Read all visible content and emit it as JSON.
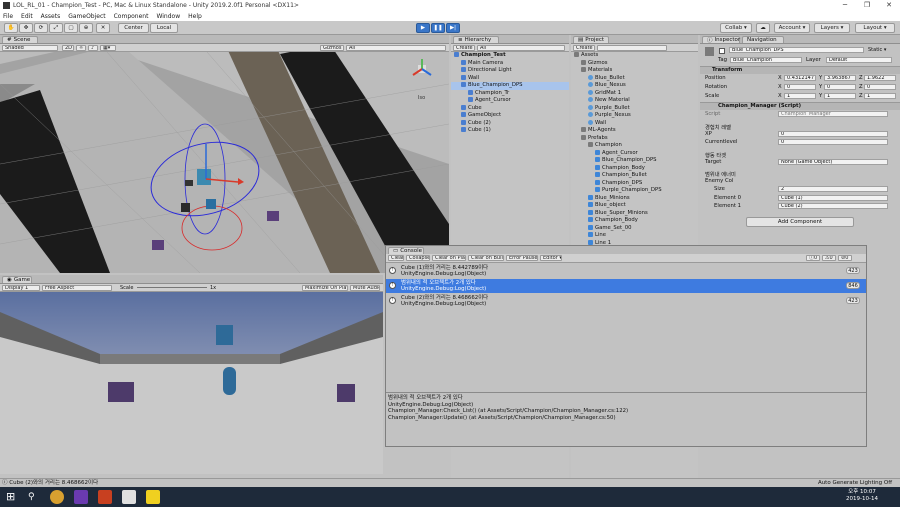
{
  "window": {
    "title": "LOL_RL_01 - Champion_Test - PC, Mac & Linux Standalone - Unity 2019.2.0f1 Personal <DX11>"
  },
  "menu": [
    "File",
    "Edit",
    "Assets",
    "GameObject",
    "Component",
    "Window",
    "Help"
  ],
  "toolbar": {
    "pivot_label": "Center",
    "space_label": "Local",
    "collab_label": "Collab ▾",
    "account_label": "Account ▾",
    "layers_label": "Layers ▾",
    "layout_label": "Layout ▾"
  },
  "scene": {
    "tab": "Scene",
    "shading": "Shaded",
    "mode_2d": "2D",
    "gizmos": "Gizmos ▾",
    "search_placeholder": "All",
    "persp": "Iso"
  },
  "game": {
    "tab": "Game",
    "display": "Display 1",
    "aspect": "Free Aspect",
    "scale_label": "Scale",
    "scale_value": "1x",
    "maximize": "Maximize On Play",
    "mute": "Mute Audio"
  },
  "hierarchy": {
    "tab": "Hierarchy",
    "create": "Create ▾",
    "search_placeholder": "All",
    "items": [
      {
        "label": "Champion_Test",
        "depth": 0,
        "kind": "scene"
      },
      {
        "label": "Main Camera",
        "depth": 1,
        "kind": "go"
      },
      {
        "label": "Directional Light",
        "depth": 1,
        "kind": "go"
      },
      {
        "label": "Wall",
        "depth": 1,
        "kind": "go"
      },
      {
        "label": "Blue_Champion_DPS",
        "depth": 1,
        "kind": "go",
        "selected": true
      },
      {
        "label": "Champion_Tr",
        "depth": 2,
        "kind": "go"
      },
      {
        "label": "Agent_Cursor",
        "depth": 2,
        "kind": "go"
      },
      {
        "label": "Cube",
        "depth": 1,
        "kind": "go"
      },
      {
        "label": "GameObject",
        "depth": 1,
        "kind": "go"
      },
      {
        "label": "Cube (2)",
        "depth": 1,
        "kind": "go"
      },
      {
        "label": "Cube (1)",
        "depth": 1,
        "kind": "go"
      }
    ]
  },
  "project": {
    "tab": "Project",
    "create": "Create ▾",
    "items": [
      {
        "label": "Assets",
        "depth": 0,
        "kind": "folder"
      },
      {
        "label": "Gizmos",
        "depth": 1,
        "kind": "folder"
      },
      {
        "label": "Materials",
        "depth": 1,
        "kind": "folder"
      },
      {
        "label": "Blue_Bullet",
        "depth": 2,
        "kind": "mat"
      },
      {
        "label": "Blue_Nexus",
        "depth": 2,
        "kind": "mat"
      },
      {
        "label": "GridMat 1",
        "depth": 2,
        "kind": "mat"
      },
      {
        "label": "New Material",
        "depth": 2,
        "kind": "mat"
      },
      {
        "label": "Purple_Bullet",
        "depth": 2,
        "kind": "mat"
      },
      {
        "label": "Purple_Nexus",
        "depth": 2,
        "kind": "mat"
      },
      {
        "label": "Wall",
        "depth": 2,
        "kind": "mat"
      },
      {
        "label": "ML-Agents",
        "depth": 1,
        "kind": "folder"
      },
      {
        "label": "Prefabs",
        "depth": 1,
        "kind": "folder"
      },
      {
        "label": "Champion",
        "depth": 2,
        "kind": "folder"
      },
      {
        "label": "Agent_Cursor",
        "depth": 3,
        "kind": "prefab"
      },
      {
        "label": "Blue_Champion_DPS",
        "depth": 3,
        "kind": "prefab"
      },
      {
        "label": "Champion_Body",
        "depth": 3,
        "kind": "prefab"
      },
      {
        "label": "Champion_Bullet",
        "depth": 3,
        "kind": "prefab"
      },
      {
        "label": "Champion_DPS",
        "depth": 3,
        "kind": "prefab"
      },
      {
        "label": "Purple_Champion_DPS",
        "depth": 3,
        "kind": "prefab"
      },
      {
        "label": "Blue_Minions",
        "depth": 2,
        "kind": "prefab"
      },
      {
        "label": "Blue_object",
        "depth": 2,
        "kind": "prefab"
      },
      {
        "label": "Blue_Super_Minions",
        "depth": 2,
        "kind": "prefab"
      },
      {
        "label": "Champion_Body",
        "depth": 2,
        "kind": "prefab"
      },
      {
        "label": "Game_Set_00",
        "depth": 2,
        "kind": "prefab"
      },
      {
        "label": "Line",
        "depth": 2,
        "kind": "prefab"
      },
      {
        "label": "Line 1",
        "depth": 2,
        "kind": "prefab"
      }
    ]
  },
  "inspector": {
    "tab": "Inspector",
    "nav_tab": "Navigation",
    "object_name": "Blue_Champion_DPS",
    "static_label": "Static ▾",
    "tag_label": "Tag",
    "tag_value": "Blue_Champion",
    "layer_label": "Layer",
    "layer_value": "Default",
    "transform": {
      "title": "Transform",
      "position": {
        "label": "Position",
        "x": "0.4312147",
        "y": "3.963867",
        "z": "1.9622"
      },
      "rotation": {
        "label": "Rotation",
        "x": "0",
        "y": "0",
        "z": "0"
      },
      "scale": {
        "label": "Scale",
        "x": "1",
        "y": "1",
        "z": "1"
      }
    },
    "script_component": {
      "title": "Champion_Manager (Script)",
      "script_label": "Script",
      "script_value": "Champion_Manager",
      "section1": "경험치 레벨",
      "xp_label": "XP",
      "xp_value": "0",
      "level_label": "Currentlevel",
      "level_value": "0",
      "section2": "행동 타겟",
      "target_label": "Target",
      "target_value": "None (Game Object)",
      "section3": "범위내 에너미",
      "enemy_col": "Enemy Col",
      "size_label": "Size",
      "size_value": "2",
      "el0_label": "Element 0",
      "el0_value": "Cube (1)",
      "el1_label": "Element 1",
      "el1_value": "Cube (2)"
    },
    "add_component": "Add Component"
  },
  "console": {
    "tab": "Console",
    "buttons": [
      "Clear",
      "Collapse",
      "Clear on Play",
      "Clear on Build",
      "Error Pause",
      "Editor ▾"
    ],
    "count_info": "0",
    "count_warn": "0",
    "count_err": "0",
    "entries": [
      {
        "line1": "Cube (1)와의 거리는 8.442789이다",
        "line2": "UnityEngine.Debug:Log(Object)",
        "count": "423",
        "selected": false
      },
      {
        "line1": "범위내의 적 오브젝트가 2개 있다",
        "line2": "UnityEngine.Debug:Log(Object)",
        "count": "846",
        "selected": true
      },
      {
        "line1": "Cube (2)와의 거리는 8.468662이다",
        "line2": "UnityEngine.Debug:Log(Object)",
        "count": "423",
        "selected": false
      }
    ],
    "detail": [
      "범위내의 적 오브젝트가 2개 있다",
      "UnityEngine.Debug:Log(Object)",
      "Champion_Manager:Check_List() (at Assets/Script/Champion/Champion_Manager.cs:122)",
      "Champion_Manager:Update() (at Assets/Script/Champion/Champion_Manager.cs:50)"
    ]
  },
  "status": {
    "message": "Cube (2)와의 거리는 8.468662이다",
    "right": "Auto Generate Lighting Off"
  },
  "taskbar": {
    "time": "오후 10:07",
    "date": "2019-10-14"
  }
}
